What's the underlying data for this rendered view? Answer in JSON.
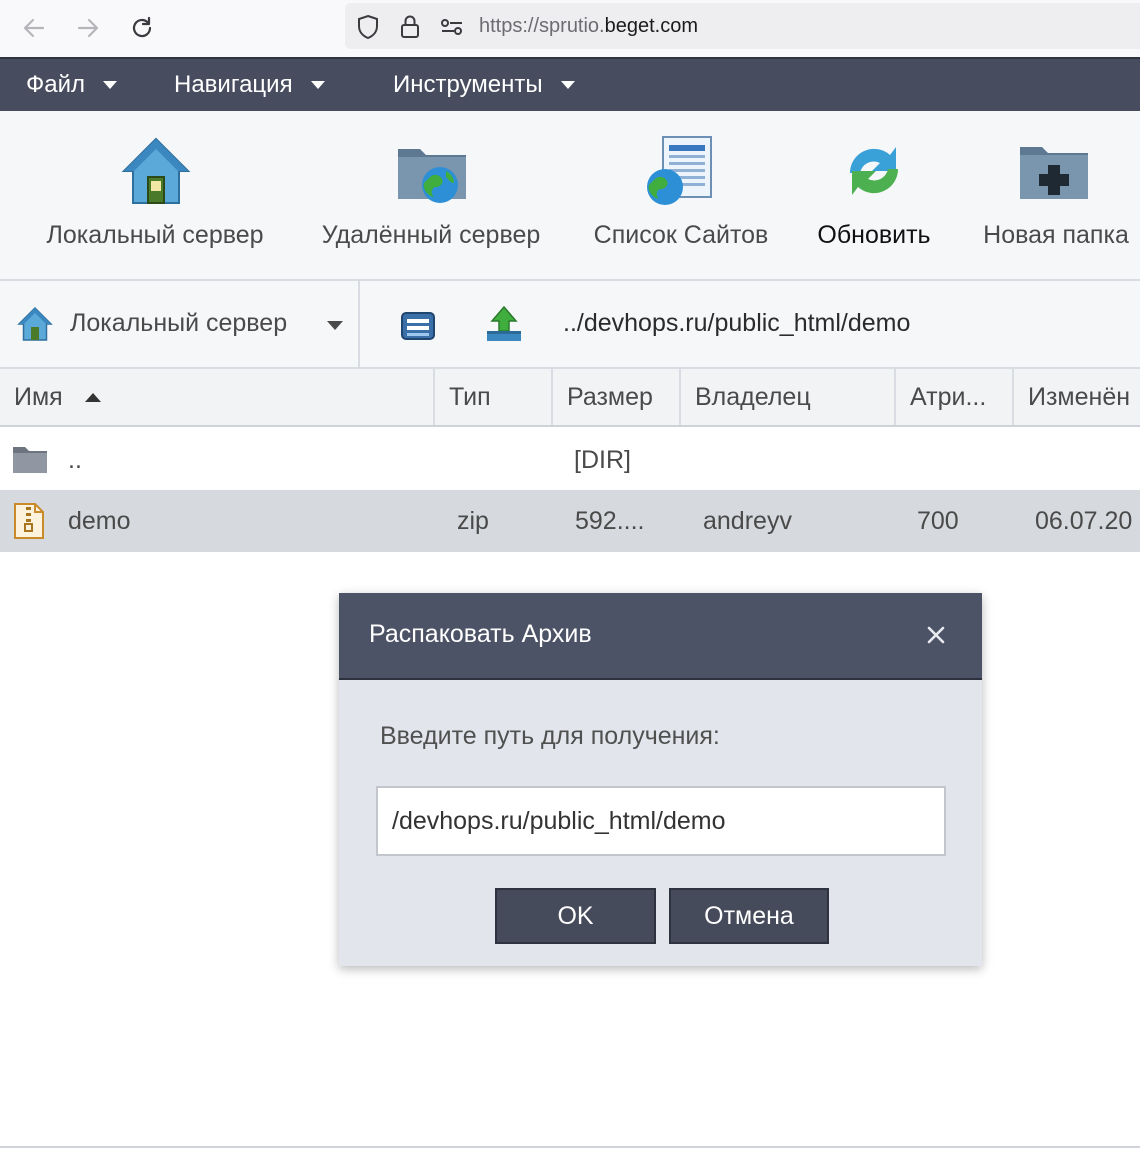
{
  "browser": {
    "url_prefix": "https://sprutio.",
    "url_host": "beget.com",
    "icons": [
      "back-arrow-icon",
      "forward-arrow-icon",
      "reload-icon",
      "tracking-shield-icon",
      "lock-icon",
      "permissions-icon"
    ]
  },
  "menu": {
    "file": "Файл",
    "navigation": "Навигация",
    "tools": "Инструменты"
  },
  "toolbar": {
    "local_server": "Локальный сервер",
    "remote_server": "Удалённый сервер",
    "site_list": "Список Сайтов",
    "refresh": "Обновить",
    "new_folder": "Новая папка"
  },
  "pathbar": {
    "server": "Локальный сервер",
    "path": "../devhops.ru/public_html/demo"
  },
  "table": {
    "columns": {
      "name": "Имя",
      "type": "Тип",
      "size": "Размер",
      "owner": "Владелец",
      "attributes": "Атри...",
      "modified": "Изменён"
    },
    "rows": [
      {
        "name": "..",
        "type": "",
        "size": "[DIR]",
        "owner": "",
        "attributes": "",
        "modified": ""
      },
      {
        "name": "demo",
        "type": "zip",
        "size": "592....",
        "owner": "andreyv",
        "attributes": "700",
        "modified": "06.07.20"
      }
    ]
  },
  "dialog": {
    "title": "Распаковать Архив",
    "prompt": "Введите путь для получения:",
    "input_value": "/devhops.ru/public_html/demo",
    "ok": "OK",
    "cancel": "Отмена"
  },
  "colors": {
    "menubar": "#474d5e",
    "dialog_header": "#4d5366",
    "dialog_body": "#e2e6ec",
    "selected_row": "#d6d9de",
    "button": "#464b5c"
  }
}
